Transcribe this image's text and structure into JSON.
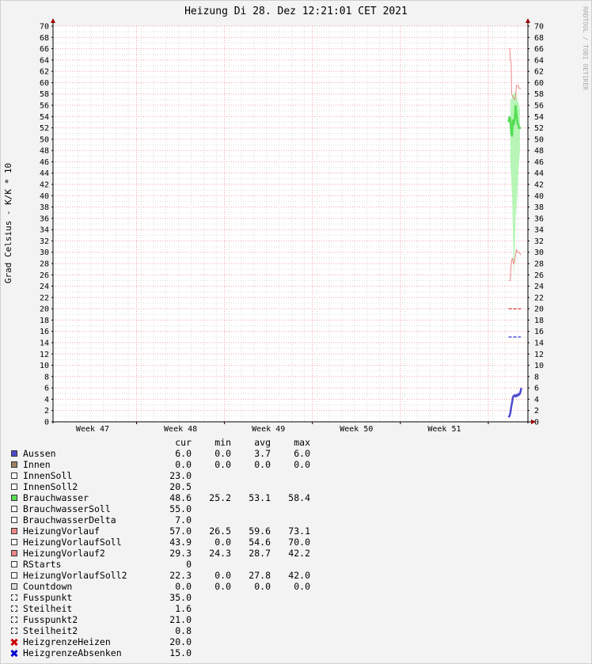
{
  "chart_data": {
    "type": "line",
    "title": "Heizung Di 28. Dez 12:21:01 CET 2021",
    "ylabel": "Grad Celsius - K/K * 10",
    "watermark": "RRDTOOL / TOBI OETIKER",
    "ylim": [
      0,
      70
    ],
    "yticks": [
      0,
      2,
      4,
      6,
      8,
      10,
      12,
      14,
      16,
      18,
      20,
      22,
      24,
      26,
      28,
      30,
      32,
      34,
      36,
      38,
      40,
      42,
      44,
      46,
      48,
      50,
      52,
      54,
      56,
      58,
      60,
      62,
      64,
      66,
      68,
      70
    ],
    "xlim": [
      46.55,
      51.95
    ],
    "xticks": [
      {
        "label": "Week 47",
        "value": 47.0
      },
      {
        "label": "Week 48",
        "value": 48.0
      },
      {
        "label": "Week 49",
        "value": 49.0
      },
      {
        "label": "Week 50",
        "value": 50.0
      },
      {
        "label": "Week 51",
        "value": 51.0
      }
    ],
    "grid": true,
    "legend_headers": [
      "cur",
      "min",
      "avg",
      "max"
    ],
    "series": [
      {
        "name": "Aussen",
        "color": "#4b4bcc",
        "style": "box",
        "cur": "6.0",
        "min": "0.0",
        "avg": "3.7",
        "max": "6.0",
        "points": [
          [
            51.73,
            0.8
          ],
          [
            51.74,
            1.0
          ],
          [
            51.75,
            1.5
          ],
          [
            51.76,
            2.6
          ],
          [
            51.77,
            3.4
          ],
          [
            51.78,
            4.4
          ],
          [
            51.79,
            4.6
          ],
          [
            51.8,
            4.7
          ],
          [
            51.81,
            4.5
          ],
          [
            51.82,
            4.7
          ],
          [
            51.83,
            4.6
          ],
          [
            51.84,
            4.9
          ],
          [
            51.85,
            4.8
          ],
          [
            51.86,
            5.0
          ],
          [
            51.87,
            5.6
          ],
          [
            51.875,
            6.0
          ]
        ]
      },
      {
        "name": "Innen",
        "color": "#a08060",
        "style": "box",
        "cur": "0.0",
        "min": "0.0",
        "avg": "0.0",
        "max": "0.0",
        "points": []
      },
      {
        "name": "InnenSoll",
        "color": "#ffffff",
        "style": "box",
        "cur": "23.0",
        "min": "",
        "avg": "",
        "max": "",
        "points": []
      },
      {
        "name": "InnenSoll2",
        "color": "#ffffff",
        "style": "box",
        "cur": "20.5",
        "min": "",
        "avg": "",
        "max": "",
        "points": []
      },
      {
        "name": "Brauchwasser",
        "color": "#55dd55",
        "style": "box",
        "cur": "48.6",
        "min": "25.2",
        "avg": "53.1",
        "max": "58.4",
        "points": [
          [
            51.73,
            53.0
          ],
          [
            51.74,
            54.0
          ],
          [
            51.75,
            53.5
          ],
          [
            51.76,
            51.0
          ],
          [
            51.77,
            50.5
          ],
          [
            51.78,
            53.5
          ],
          [
            51.79,
            52.5
          ],
          [
            51.8,
            53.5
          ],
          [
            51.81,
            56.0
          ],
          [
            51.82,
            54.5
          ],
          [
            51.83,
            53.0
          ],
          [
            51.84,
            52.5
          ],
          [
            51.85,
            52.0
          ],
          [
            51.86,
            52.0
          ],
          [
            51.87,
            52.0
          ]
        ]
      },
      {
        "name": "BrauchwasserSoll",
        "color": "#ffffff",
        "style": "box",
        "cur": "55.0",
        "min": "",
        "avg": "",
        "max": "",
        "points": []
      },
      {
        "name": "BrauchwasserDelta",
        "color": "#ffffff",
        "style": "box",
        "cur": "7.0",
        "min": "",
        "avg": "",
        "max": "",
        "points": []
      },
      {
        "name": "HeizungVorlauf",
        "color": "#ee8888",
        "style": "box",
        "cur": "57.0",
        "min": "26.5",
        "avg": "59.6",
        "max": "73.1",
        "points": [
          [
            51.73,
            66.0
          ],
          [
            51.745,
            66.0
          ],
          [
            51.75,
            64.0
          ],
          [
            51.76,
            63.5
          ],
          [
            51.765,
            58.0
          ],
          [
            51.78,
            57.5
          ],
          [
            51.8,
            57.0
          ],
          [
            51.81,
            57.5
          ],
          [
            51.82,
            59.5
          ],
          [
            51.84,
            59.5
          ],
          [
            51.85,
            59.0
          ],
          [
            51.87,
            59.0
          ]
        ]
      },
      {
        "name": "HeizungVorlaufSoll",
        "color": "#ffffff",
        "style": "box",
        "cur": "43.9",
        "min": "0.0",
        "avg": "54.6",
        "max": "70.0",
        "points": []
      },
      {
        "name": "HeizungVorlauf2",
        "color": "#ee8888",
        "style": "box",
        "cur": "29.3",
        "min": "24.3",
        "avg": "28.7",
        "max": "42.2",
        "points": [
          [
            51.73,
            25.0
          ],
          [
            51.75,
            25.0
          ],
          [
            51.755,
            27.0
          ],
          [
            51.765,
            28.5
          ],
          [
            51.775,
            29.0
          ],
          [
            51.785,
            28.0
          ],
          [
            51.795,
            28.0
          ],
          [
            51.8,
            28.5
          ],
          [
            51.81,
            29.5
          ],
          [
            51.82,
            30.5
          ],
          [
            51.83,
            30.0
          ],
          [
            51.85,
            30.0
          ],
          [
            51.87,
            29.5
          ]
        ]
      },
      {
        "name": "RStarts",
        "color": "#ffffff",
        "style": "box",
        "cur": "0",
        "min": "",
        "avg": "",
        "max": "",
        "points": []
      },
      {
        "name": "HeizungVorlaufSoll2",
        "color": "#ffffff",
        "style": "box",
        "cur": "22.3",
        "min": "0.0",
        "avg": "27.8",
        "max": "42.0",
        "points": []
      },
      {
        "name": "Countdown",
        "color": "#dddddd",
        "style": "box",
        "cur": "0.0",
        "min": "0.0",
        "avg": "0.0",
        "max": "0.0",
        "points": []
      },
      {
        "name": "Fusspunkt",
        "color": "#ffffff",
        "style": "dashed",
        "cur": "35.0",
        "min": "",
        "avg": "",
        "max": "",
        "points": []
      },
      {
        "name": "Steilheit",
        "color": "#ffffff",
        "style": "dashed",
        "cur": "1.6",
        "min": "",
        "avg": "",
        "max": "",
        "points": []
      },
      {
        "name": "Fusspunkt2",
        "color": "#ffffff",
        "style": "dashed",
        "cur": "21.0",
        "min": "",
        "avg": "",
        "max": "",
        "points": []
      },
      {
        "name": "Steilheit2",
        "color": "#ffffff",
        "style": "dashed",
        "cur": "0.8",
        "min": "",
        "avg": "",
        "max": "",
        "points": []
      },
      {
        "name": "HeizgrenzeHeizen",
        "color": "#cc0000",
        "style": "cross",
        "cur": "20.0",
        "min": "",
        "avg": "",
        "max": "",
        "points": [
          [
            51.73,
            20.0
          ],
          [
            51.87,
            20.0
          ]
        ]
      },
      {
        "name": "HeizgrenzeAbsenken",
        "color": "#0000cc",
        "style": "cross",
        "cur": "15.0",
        "min": "",
        "avg": "",
        "max": "",
        "points": [
          [
            51.73,
            15.0
          ],
          [
            51.87,
            15.0
          ]
        ]
      }
    ],
    "brauchwasser_band": {
      "x": [
        51.75,
        51.76,
        51.77,
        51.78,
        51.79,
        51.8,
        51.81,
        51.82,
        51.83,
        51.84,
        51.85,
        51.86
      ],
      "low": [
        46.0,
        43.0,
        40.0,
        34.0,
        25.2,
        30.0,
        36.0,
        38.0,
        40.0,
        44.0,
        46.0,
        48.0
      ],
      "high": [
        57.0,
        57.0,
        57.5,
        58.0,
        58.0,
        58.4,
        58.4,
        57.5,
        57.0,
        56.5,
        56.0,
        55.0
      ]
    }
  }
}
